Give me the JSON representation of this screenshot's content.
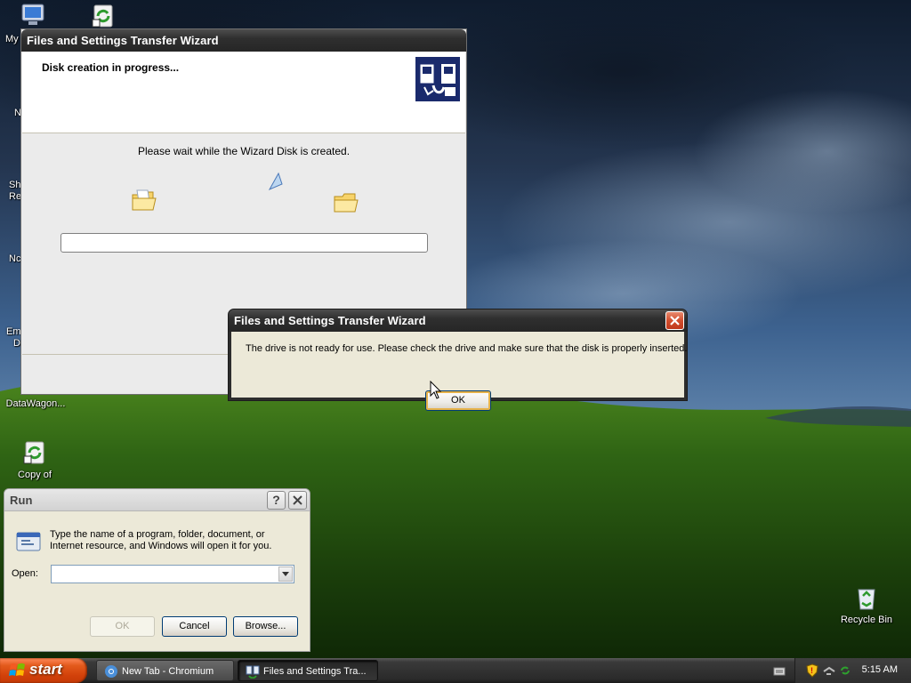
{
  "desktop": {
    "icons": [
      {
        "label": "My",
        "icon": "my-computer-icon"
      },
      {
        "label": "",
        "icon": "shortcut-sync-icon"
      },
      {
        "label": "N",
        "icon": "hidden-icon"
      },
      {
        "label": "Sh",
        "icon": "hidden-icon"
      },
      {
        "label": "Re",
        "icon": "hidden-icon"
      },
      {
        "label": "Nc",
        "icon": "hidden-icon"
      },
      {
        "label": "Em",
        "icon": "hidden-icon"
      },
      {
        "label": "D",
        "icon": "hidden-icon"
      },
      {
        "label": "DataWagon...",
        "icon": "datawagon-icon"
      },
      {
        "label": "Copy of",
        "icon": "sync-shortcut-icon"
      },
      {
        "label": "Recycle Bin",
        "icon": "recycle-bin-icon"
      }
    ]
  },
  "wizard": {
    "title": "Files and Settings Transfer Wizard",
    "heading": "Disk creation in progress...",
    "message": "Please wait while the Wizard Disk is created.",
    "progress": 0
  },
  "error_dialog": {
    "title": "Files and Settings Transfer Wizard",
    "message": "The drive is not ready for use. Please check the drive and make sure that the disk is properly inserted.",
    "ok_label": "OK"
  },
  "run_dialog": {
    "title": "Run",
    "description": "Type the name of a program, folder, document, or Internet resource, and Windows will open it for you.",
    "open_label": "Open:",
    "open_value": "",
    "ok_label": "OK",
    "cancel_label": "Cancel",
    "browse_label": "Browse..."
  },
  "taskbar": {
    "start_label": "start",
    "buttons": [
      {
        "label": "New Tab - Chromium",
        "icon": "chromium-icon",
        "active": false
      },
      {
        "label": "Files and Settings Tra...",
        "icon": "transfer-wizard-icon",
        "active": true
      }
    ],
    "clock": "5:15 AM"
  },
  "colors": {
    "titlebar_dark": "#2f2f2f",
    "close_button": "#d9412a",
    "start_button": "#d2410a",
    "focus_ring": "#e7b34a"
  }
}
